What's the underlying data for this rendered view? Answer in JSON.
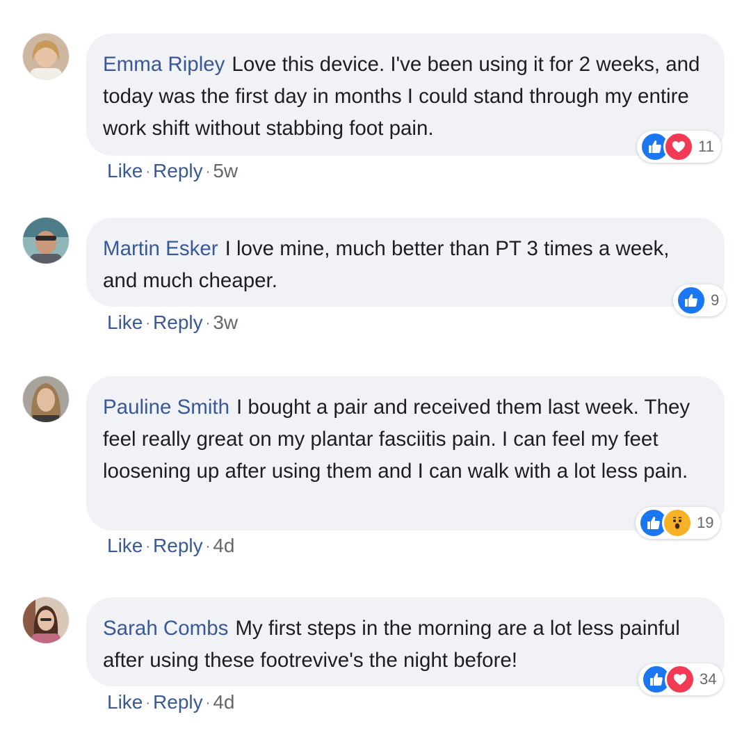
{
  "comments": [
    {
      "author": "Emma Ripley",
      "text": "Love this device. I've been using it for 2 weeks, and today was the first day in months I could stand through my entire work shift without stabbing foot pain.",
      "reactions": [
        "like",
        "love"
      ],
      "reaction_count": "11",
      "like_label": "Like",
      "reply_label": "Reply",
      "separator": "·",
      "time": "5w"
    },
    {
      "author": "Martin Esker",
      "text": "I love mine, much better than PT 3 times a week, and much cheaper.",
      "reactions": [
        "like"
      ],
      "reaction_count": "9",
      "like_label": "Like",
      "reply_label": "Reply",
      "separator": "·",
      "time": "3w"
    },
    {
      "author": "Pauline Smith",
      "text": "I bought a pair and received them last week. They feel really great on my plantar fasciitis pain. I can feel my feet loosening up after using them and I can walk with a lot less pain.",
      "reactions": [
        "like",
        "wow"
      ],
      "reaction_count": "19",
      "like_label": "Like",
      "reply_label": "Reply",
      "separator": "·",
      "time": "4d"
    },
    {
      "author": "Sarah Combs",
      "text": "My first steps in the morning are a lot less painful after using these footrevive's the night before!",
      "reactions": [
        "like",
        "love"
      ],
      "reaction_count": "34",
      "like_label": "Like",
      "reply_label": "Reply",
      "separator": "·",
      "time": "4d"
    }
  ],
  "colors": {
    "author": "#385898",
    "bubble": "#f0f2f5",
    "like": "#1b76f2",
    "love": "#f23a55",
    "wow": "#f7b125"
  }
}
